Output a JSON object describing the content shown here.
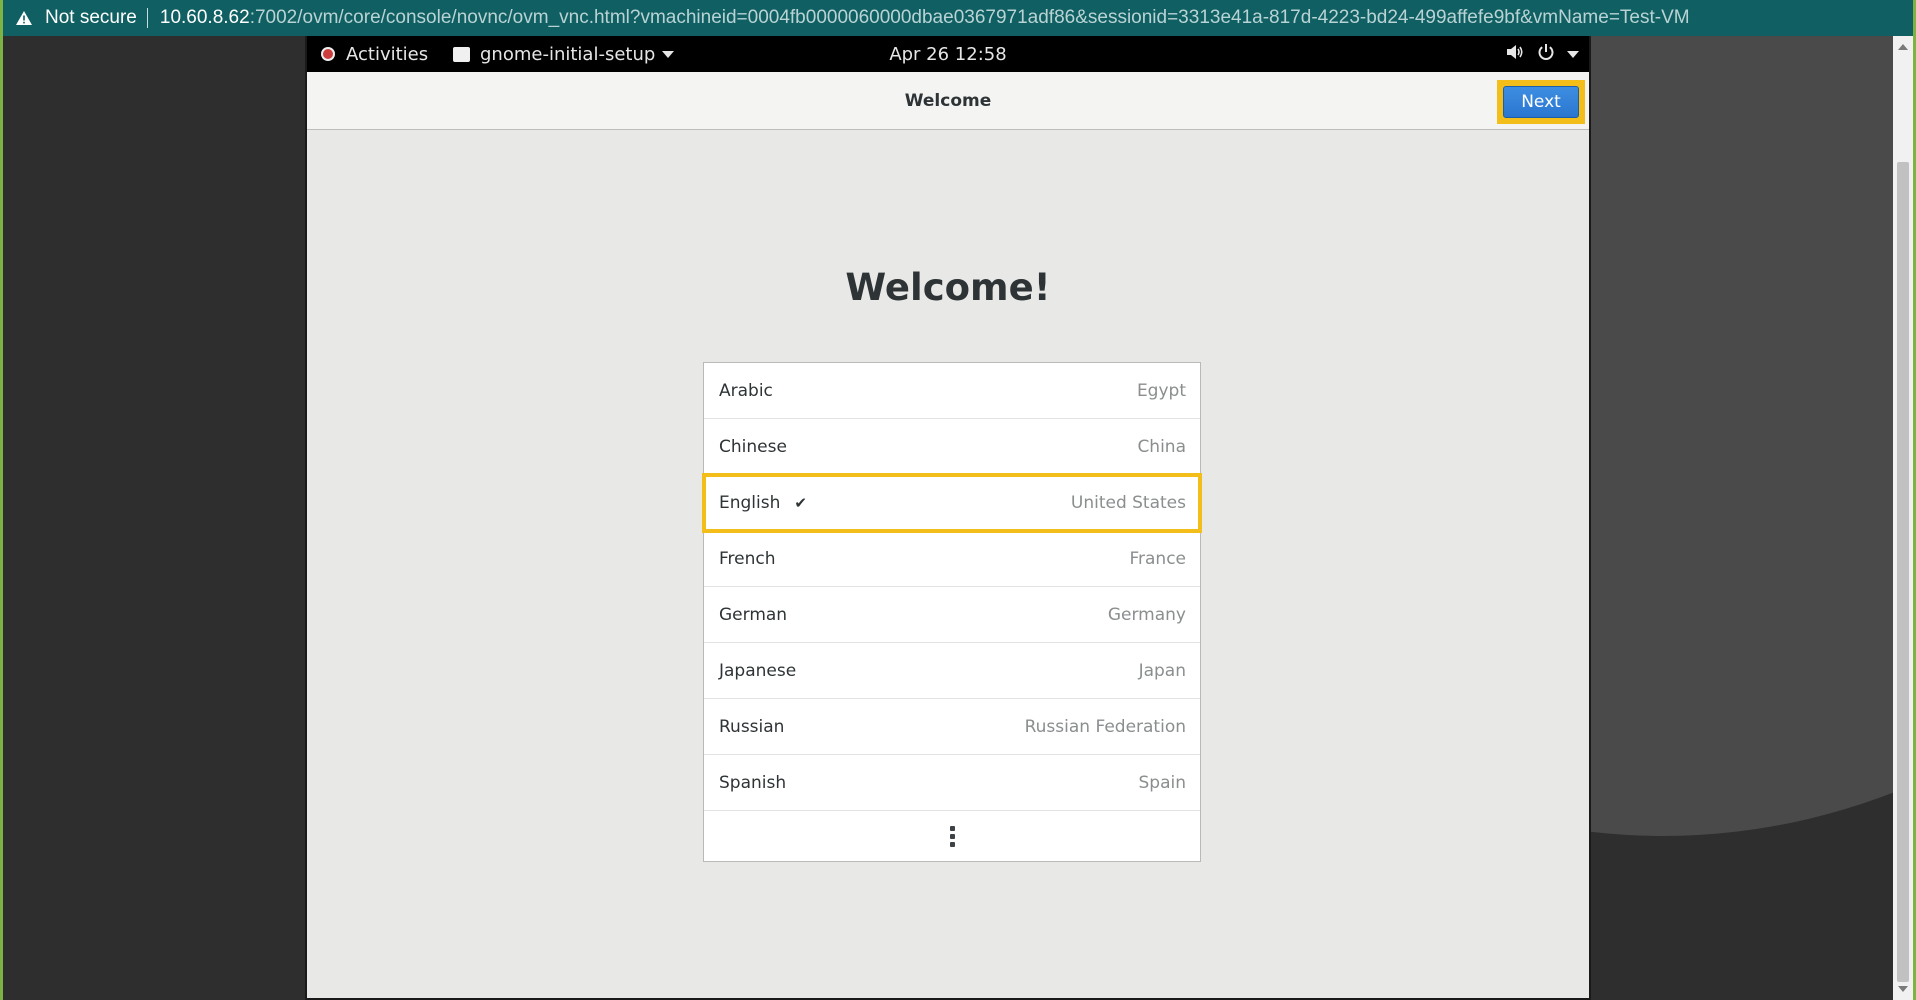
{
  "browser": {
    "security_label": "Not secure",
    "url_host": "10.60.8.62",
    "url_rest": ":7002/ovm/core/console/novnc/ovm_vnc.html?vmachineid=0004fb0000060000dbae0367971adf86&sessionid=3313e41a-817d-4223-bd24-499affefe9bf&vmName=Test-VM"
  },
  "topbar": {
    "activities_label": "Activities",
    "app_name": "gnome-initial-setup",
    "clock": "Apr 26  12:58",
    "icons": [
      "volume-icon",
      "power-icon",
      "chevron-down-icon"
    ]
  },
  "header": {
    "title": "Welcome",
    "next_label": "Next"
  },
  "main": {
    "heading": "Welcome!",
    "languages": [
      {
        "name": "Arabic",
        "country": "Egypt"
      },
      {
        "name": "Chinese",
        "country": "China"
      },
      {
        "name": "English",
        "country": "United States",
        "selected": true
      },
      {
        "name": "French",
        "country": "France"
      },
      {
        "name": "German",
        "country": "Germany"
      },
      {
        "name": "Japanese",
        "country": "Japan"
      },
      {
        "name": "Russian",
        "country": "Russian Federation"
      },
      {
        "name": "Spanish",
        "country": "Spain"
      }
    ],
    "check_glyph": "✔"
  },
  "colors": {
    "highlight": "#f4be1a",
    "next_button": "#2a76cf",
    "address_bar": "#0f5f63"
  }
}
